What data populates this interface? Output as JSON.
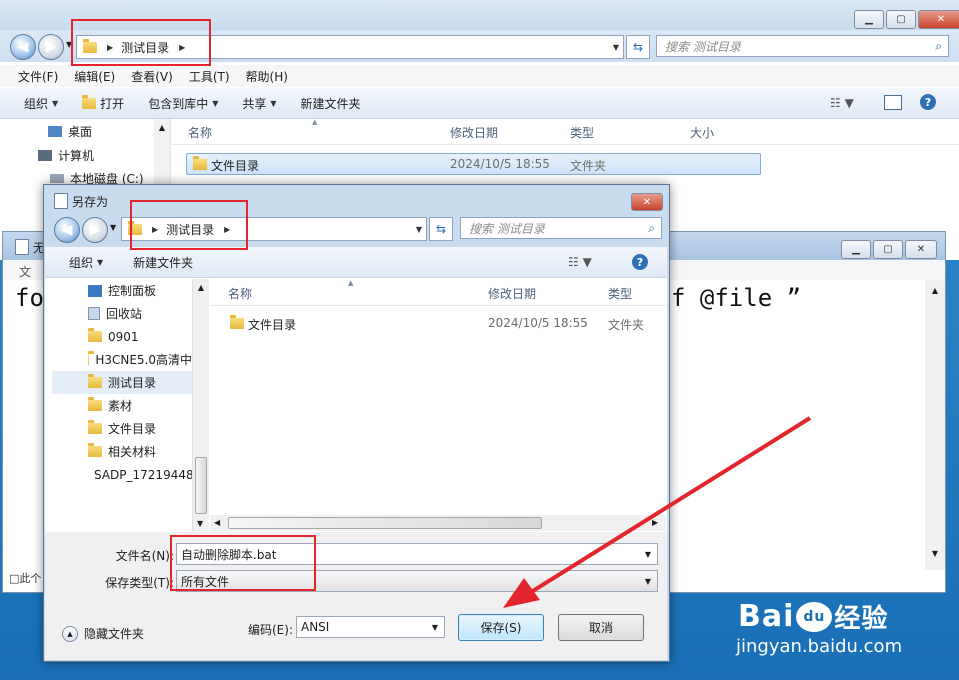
{
  "explorer": {
    "breadcrumb": "测试目录",
    "search_placeholder": "搜索 测试目录",
    "menu": [
      "文件(F)",
      "编辑(E)",
      "查看(V)",
      "工具(T)",
      "帮助(H)"
    ],
    "toolbar": {
      "organize": "组织",
      "open": "打开",
      "include": "包含到库中",
      "share": "共享",
      "new_folder": "新建文件夹"
    },
    "nav": [
      "桌面",
      "计算机",
      "本地磁盘 (C:)"
    ],
    "columns": {
      "name": "名称",
      "date": "修改日期",
      "type": "类型",
      "size": "大小"
    },
    "file": {
      "name": "文件目录",
      "date": "2024/10/5 18:55",
      "type": "文件夹"
    }
  },
  "notepad": {
    "title_fragment": "无",
    "menu_fragment": "文",
    "text_left": "fo",
    "text_right": "f @file ”",
    "status_fragment": "□此个"
  },
  "dialog": {
    "title": "另存为",
    "breadcrumb": "测试目录",
    "search_placeholder": "搜索 测试目录",
    "toolbar": {
      "organize": "组织",
      "new_folder": "新建文件夹"
    },
    "tree": [
      {
        "label": "控制面板",
        "icon": "control-panel-icon"
      },
      {
        "label": "回收站",
        "icon": "recycle-bin-icon"
      },
      {
        "label": "0901",
        "icon": "folder-icon"
      },
      {
        "label": "H3CNE5.0高清中",
        "icon": "folder-icon"
      },
      {
        "label": "测试目录",
        "icon": "folder-icon"
      },
      {
        "label": "素材",
        "icon": "folder-icon"
      },
      {
        "label": "文件目录",
        "icon": "folder-icon"
      },
      {
        "label": "相关材料",
        "icon": "folder-icon"
      },
      {
        "label": "SADP_17219448",
        "icon": "archive-icon"
      }
    ],
    "columns": {
      "name": "名称",
      "date": "修改日期",
      "type": "类型"
    },
    "file": {
      "name": "文件目录",
      "date": "2024/10/5 18:55",
      "type": "文件夹"
    },
    "filename_label": "文件名(N):",
    "filename_value": "自动删除脚本.bat",
    "filetype_label": "保存类型(T):",
    "filetype_value": "所有文件",
    "hide_folders": "隐藏文件夹",
    "encoding_label": "编码(E):",
    "encoding_value": "ANSI",
    "save_button": "保存(S)",
    "cancel_button": "取消"
  },
  "watermark": {
    "logo_text": "Bai",
    "logo_tail": "经验",
    "logo_paw": "du",
    "url": "jingyan.baidu.com"
  },
  "colors": {
    "annotation_red": "#e3262e",
    "desktop_blue": "#1a6fb6",
    "arrow_red": "#e3262e"
  }
}
